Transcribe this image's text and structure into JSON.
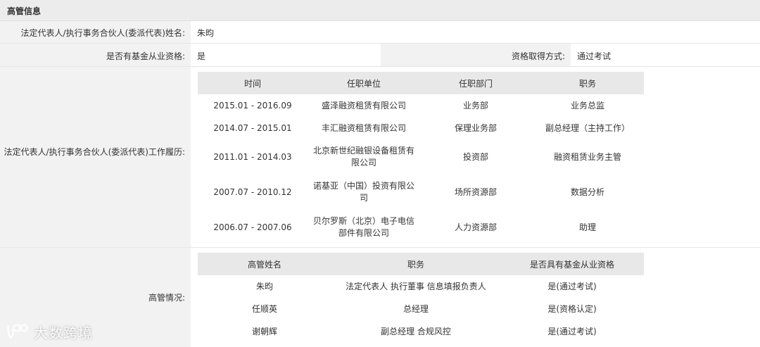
{
  "section_title": "高管信息",
  "legal_rep": {
    "label": "法定代表人/执行事务合伙人(委派代表)姓名:",
    "value": "朱昀"
  },
  "qualification": {
    "label": "是否有基金从业资格:",
    "value": "是",
    "method_label": "资格取得方式:",
    "method_value": "通过考试"
  },
  "work_history": {
    "label": "法定代表人/执行事务合伙人(委派代表)工作履历:",
    "headers": [
      "时间",
      "任职单位",
      "任职部门",
      "职务"
    ],
    "rows": [
      [
        "2015.01 - 2016.09",
        "盛泽融资租赁有限公司",
        "业务部",
        "业务总监"
      ],
      [
        "2014.07 - 2015.01",
        "丰汇融资租赁有限公司",
        "保理业务部",
        "副总经理（主持工作）"
      ],
      [
        "2011.01 - 2014.03",
        "北京新世纪融银设备租赁有限公司",
        "投资部",
        "融资租赁业务主管"
      ],
      [
        "2007.07 - 2010.12",
        "诺基亚（中国）投资有限公司",
        "场所资源部",
        "数据分析"
      ],
      [
        "2006.07 - 2007.06",
        "贝尔罗斯（北京）电子电信部件有限公司",
        "人力资源部",
        "助理"
      ]
    ]
  },
  "executives": {
    "label": "高管情况:",
    "headers": [
      "高管姓名",
      "职务",
      "是否具有基金从业资格"
    ],
    "rows": [
      [
        "朱昀",
        "法定代表人 执行董事 信息填报负责人",
        "是(通过考试)"
      ],
      [
        "任顺英",
        "总经理",
        "是(资格认定)"
      ],
      [
        "谢朝辉",
        "副总经理 合规风控",
        "是(通过考试)"
      ]
    ]
  },
  "watermark": {
    "text": "大数跨境",
    "icon": "brand-logo-icon"
  }
}
